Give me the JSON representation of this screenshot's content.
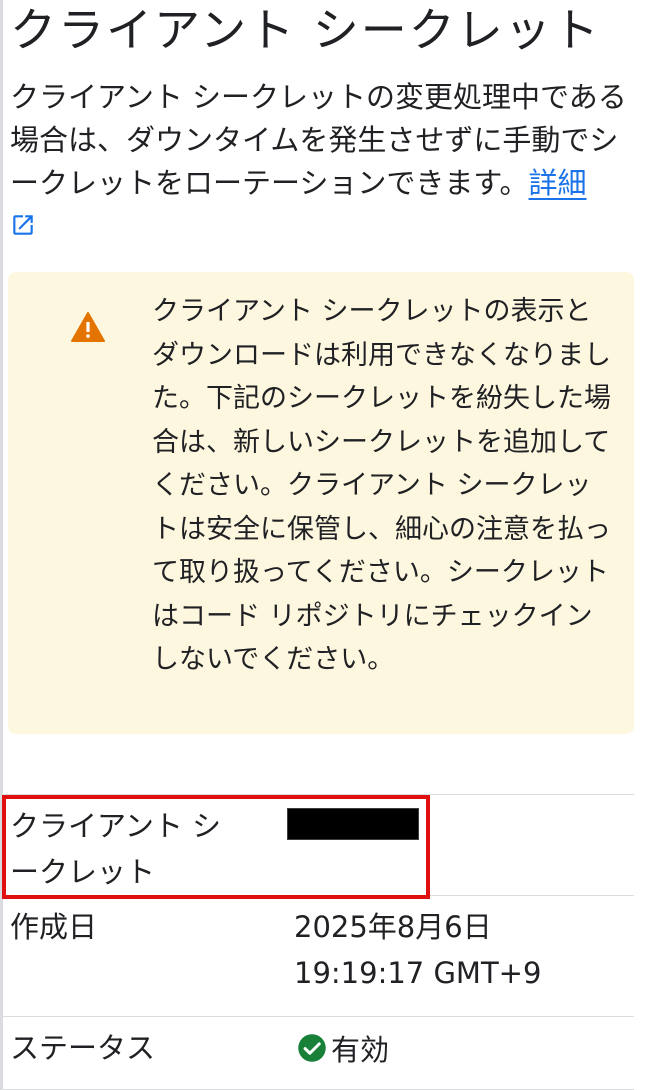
{
  "header": {
    "title": "クライアント シークレット"
  },
  "description": {
    "text": "クライアント シークレットの変更処理中である場合は、ダウンタイムを発生させずに手動でシークレットをローテーションできます。",
    "link_label": "詳細"
  },
  "warning": {
    "text": "クライアント シークレットの表示とダウンロードは利用できなくなりました。下記のシークレットを紛失した場合は、新しいシークレットを追加してください。クライアント シークレットは安全に保管し、細心の注意を払って取り扱ってください。シークレットはコード リポジトリにチェックインしないでください。"
  },
  "details": {
    "secret_label": "クライアント シークレット",
    "created_label": "作成日",
    "created_value": "2025年8月6日 19:19:17 GMT+9",
    "status_label": "ステータス",
    "status_value": "有効"
  },
  "colors": {
    "link": "#1a73e8",
    "warning_bg": "#fef7e0",
    "warning_icon": "#e37400",
    "status_ok": "#188038",
    "highlight": "#e01010"
  },
  "icons": [
    "open-in-new-icon",
    "warning-icon",
    "check-circle-icon"
  ]
}
